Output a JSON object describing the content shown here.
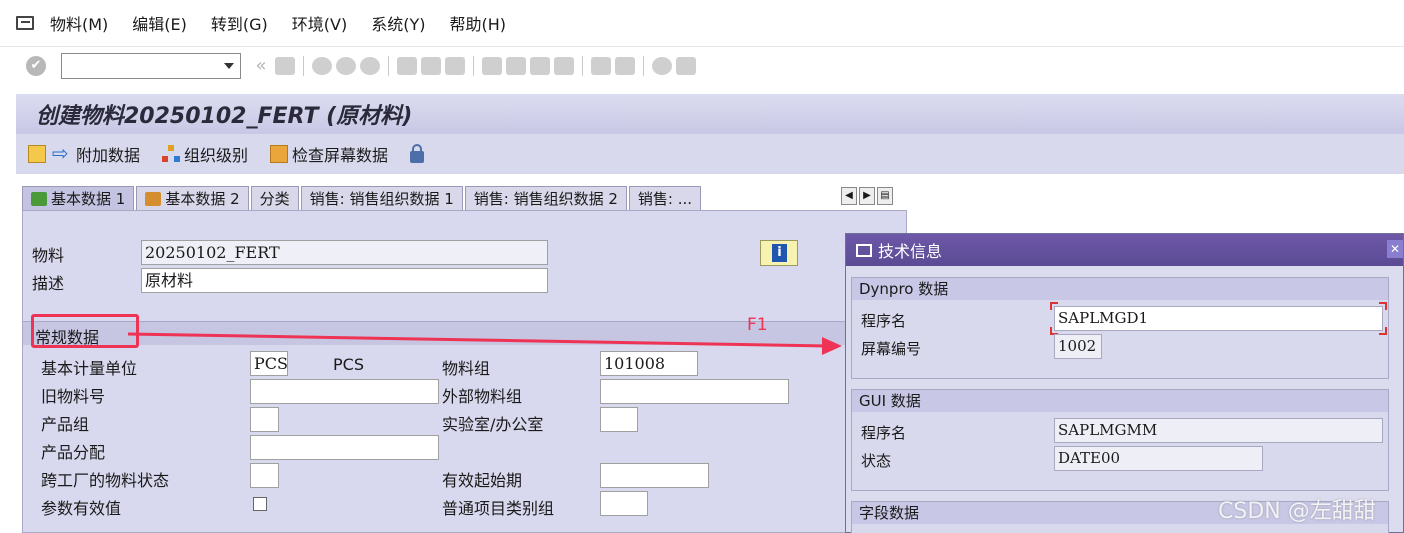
{
  "menu": [
    "物料(M)",
    "编辑(E)",
    "转到(G)",
    "环境(V)",
    "系统(Y)",
    "帮助(H)"
  ],
  "title": "创建物料20250102_FERT (原材料)",
  "app_toolbar": {
    "additional_data": "附加数据",
    "org_levels": "组织级别",
    "check_screen_data": "检查屏幕数据"
  },
  "tabs": [
    "基本数据 1",
    "基本数据 2",
    "分类",
    "销售: 销售组织数据 1",
    "销售: 销售组织数据 2",
    "销售: ..."
  ],
  "header_fields": {
    "material_label": "物料",
    "material_value": "20250102_FERT",
    "description_label": "描述",
    "description_value": "原材料"
  },
  "section_title": "常规数据",
  "general": {
    "base_uom_label": "基本计量单位",
    "base_uom_value": "PCS",
    "base_uom_text": "PCS",
    "old_material_label": "旧物料号",
    "division_label": "产品组",
    "product_allocation_label": "产品分配",
    "xplant_status_label": "跨工厂的物料状态",
    "assign_effect_label": "参数有效值",
    "material_group_label": "物料组",
    "material_group_value": "101008",
    "ext_material_group_label": "外部物料组",
    "lab_office_label": "实验室/办公室",
    "valid_from_label": "有效起始期",
    "gen_item_cat_label": "普通项目类别组"
  },
  "annotation": "F1",
  "dialog": {
    "title": "技术信息",
    "dynpro": {
      "head": "Dynpro 数据",
      "program_label": "程序名",
      "program_value": "SAPLMGD1",
      "screen_label": "屏幕编号",
      "screen_value": "1002"
    },
    "gui": {
      "head": "GUI 数据",
      "program_label": "程序名",
      "program_value": "SAPLMGMM",
      "status_label": "状态",
      "status_value": "DATE00"
    },
    "field": {
      "head": "字段数据"
    }
  },
  "watermark": "CSDN @左甜甜",
  "colors": {
    "accent": "#5a4b94",
    "highlight": "#ee3355",
    "panel": "#d8d8ee"
  }
}
